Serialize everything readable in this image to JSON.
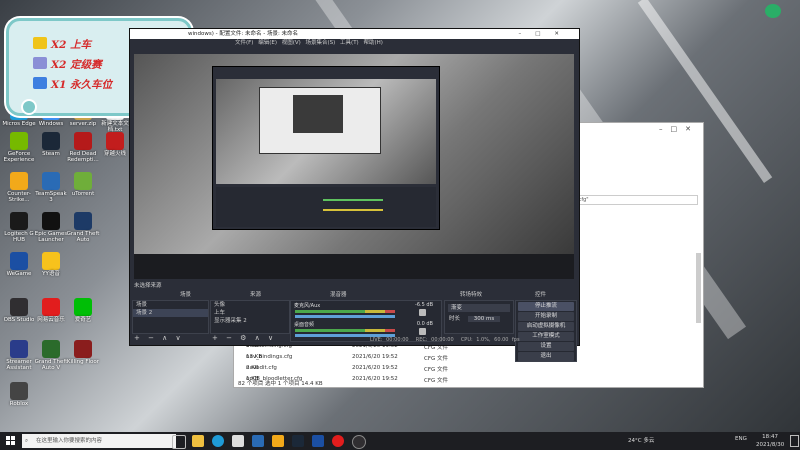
{
  "desktop": {
    "icons": [
      {
        "label": "Micros Edge",
        "color": "#1f9bd7",
        "pos": "a"
      },
      {
        "label": "Windows",
        "color": "#3f8ff2",
        "pos": "b"
      },
      {
        "label": "server.zip",
        "color": "#c8a24a",
        "pos": "c"
      },
      {
        "label": "新建文本文档.txt",
        "color": "#f3f3f3",
        "pos": "d"
      },
      {
        "label": "GeForce Experience",
        "color": "#76b900",
        "pos": "e"
      },
      {
        "label": "Steam",
        "color": "#1b2838",
        "pos": "f"
      },
      {
        "label": "Red Dead Redempti...",
        "color": "#b51a1a",
        "pos": "g"
      },
      {
        "label": "穿越火线",
        "color": "#c21d1d",
        "pos": "h"
      },
      {
        "label": "Counter-Strike...",
        "color": "#f2a91a",
        "pos": "i"
      },
      {
        "label": "TeamSpeak 3",
        "color": "#2a6bb5",
        "pos": "j"
      },
      {
        "label": "uTorrent",
        "color": "#6fae3a",
        "pos": "k"
      },
      {
        "label": "Logitech G HUB",
        "color": "#1a1a1a",
        "pos": "l"
      },
      {
        "label": "Epic Games Launcher",
        "color": "#111111",
        "pos": "m"
      },
      {
        "label": "Grand Theft Auto",
        "color": "#1d3a66",
        "pos": "n"
      },
      {
        "label": "WeGame",
        "color": "#1b4fa3",
        "pos": "o"
      },
      {
        "label": "YY语音",
        "color": "#f7c21c",
        "pos": "p"
      },
      {
        "label": "OBS Studio",
        "color": "#302e31",
        "pos": "q"
      },
      {
        "label": "网易云音乐",
        "color": "#e21d1d",
        "pos": "r"
      },
      {
        "label": "爱奇艺",
        "color": "#00be06",
        "pos": "s"
      },
      {
        "label": "Streamer Assistant",
        "color": "#2a3c8a",
        "pos": "t"
      },
      {
        "label": "Grand Theft Auto V",
        "color": "#2b6b2b",
        "pos": "u"
      },
      {
        "label": "Killing Floor",
        "color": "#8a1d1d",
        "pos": "v"
      },
      {
        "label": "Roblox",
        "color": "#444444",
        "pos": "w"
      }
    ]
  },
  "banner": {
    "lines": [
      "X2 上车",
      "X2 定级赛",
      "X1 永久车位"
    ],
    "icon_colors": [
      "#f0c419",
      "#8a8fd6",
      "#3d7fe0"
    ]
  },
  "obs": {
    "title": "windows) - 配置文件: 未命名 - 场景: 未命名",
    "menu": "文件(F) 编辑(E) 视图(V) 场景集合(S) 工具(T) 帮助(H)",
    "docks": {
      "scenes_title": "场景",
      "scenes": [
        "场景",
        "场景 2"
      ],
      "sources_title": "来源",
      "sources": [
        "头像",
        "上车",
        "显示器采集 2"
      ],
      "mixer_title": "混音器",
      "mixer": [
        {
          "name": "麦克风/Aux",
          "db": "-6.5 dB"
        },
        {
          "name": "桌面音频",
          "db": "0.0 dB"
        }
      ],
      "transitions_title": "转场特效",
      "transition_type": "渐变",
      "duration_label": "时长",
      "duration": "300 ms",
      "controls_title": "控件",
      "controls": [
        "停止推流",
        "开始录制",
        "启动虚拟摄像机",
        "工作室模式",
        "设置",
        "退出"
      ]
    },
    "status": {
      "live": "LIVE: 00:00:00",
      "rec": "REC: 00:00:00",
      "cpu": "CPU: 1.0%, 60.00 fps"
    },
    "preview_label": "未选择来源"
  },
  "explorer": {
    "files": [
      {
        "name": "bloodbinding.cfg",
        "date": "2021/6/20 19:52",
        "type": "CFG 文件",
        "size": "1 KB"
      },
      {
        "name": "nav_bindings.cfg",
        "date": "2021/6/20 19:52",
        "type": "CFG 文件",
        "size": "13 KB"
      },
      {
        "name": "navedit.cfg",
        "date": "2021/6/20 19:52",
        "type": "CFG 文件",
        "size": "2 KB"
      },
      {
        "name": "op08_bloodletter.cfg",
        "date": "2021/6/20 19:52",
        "type": "CFG 文件",
        "size": "1 KB"
      }
    ],
    "status": "82 个项目    选中 1 个项目  14.4 KB",
    "path_hint": ".cfg\""
  },
  "taskbar": {
    "search_placeholder": "在这里输入你要搜索的内容",
    "weather": "24°C 多云",
    "lang": "ENG",
    "time": "18:47",
    "date": "2021/8/30"
  },
  "colors": {
    "obs_bg": "#2b2e38",
    "banner_text": "#d62a2a",
    "banner_border": "#7ec8c8"
  }
}
